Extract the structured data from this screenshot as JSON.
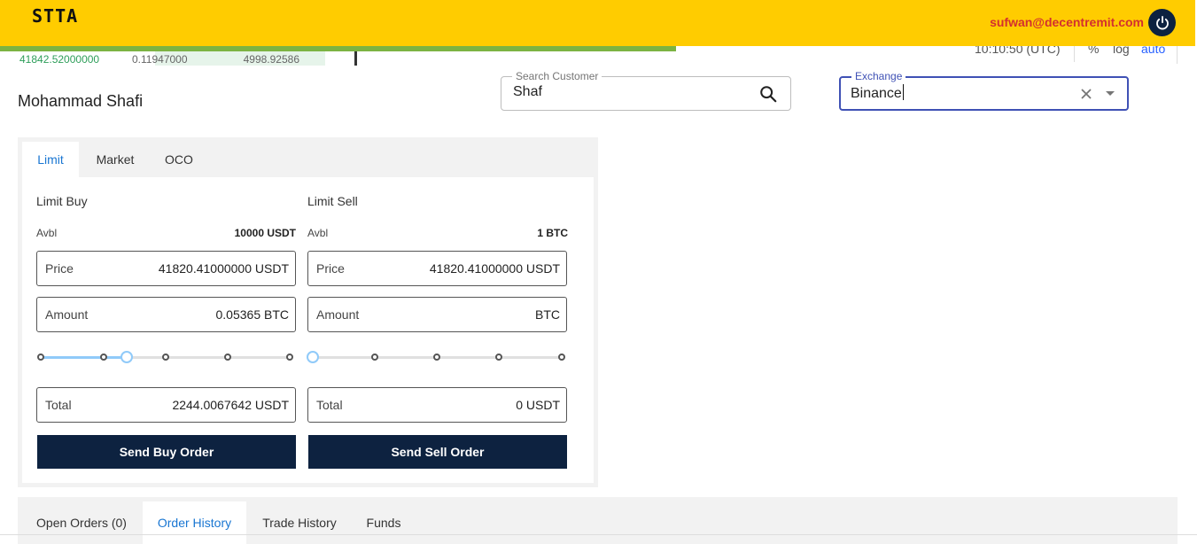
{
  "header": {
    "brand": "STTA",
    "user_email": "sufwan@decentremit.com",
    "power_icon": "power-icon",
    "colors": {
      "bar": "#ffcc00",
      "email": "#d32f2f",
      "power": "#0d2240"
    }
  },
  "background_strip": {
    "orderbook_row": {
      "price": "41842.52000000",
      "qty": "0.11947000",
      "total": "4998.92586"
    },
    "time": "10:10:50 (UTC)",
    "percent": "%",
    "log": "log",
    "auto": "auto"
  },
  "customer": {
    "name": "Mohammad Shafi"
  },
  "search": {
    "label": "Search Customer",
    "value": "Shaf"
  },
  "exchange": {
    "label": "Exchange",
    "value": "Binance"
  },
  "order_tabs": [
    "Limit",
    "Market",
    "OCO"
  ],
  "active_order_tab": "Limit",
  "buy": {
    "title": "Limit Buy",
    "avbl_label": "Avbl",
    "avbl_value": "10000 USDT",
    "price_label": "Price",
    "price_value": "41820.41000000 USDT",
    "amount_label": "Amount",
    "amount_value": "0.05365 BTC",
    "slider_percent": 25,
    "total_label": "Total",
    "total_value": "2244.0067642 USDT",
    "button": "Send Buy Order"
  },
  "sell": {
    "title": "Limit Sell",
    "avbl_label": "Avbl",
    "avbl_value": "1 BTC",
    "price_label": "Price",
    "price_value": "41820.41000000 USDT",
    "amount_label": "Amount",
    "amount_value": "BTC",
    "slider_percent": 0,
    "total_label": "Total",
    "total_value": "0 USDT",
    "button": "Send Sell Order"
  },
  "bottom_tabs": [
    "Open Orders (0)",
    "Order History",
    "Trade History",
    "Funds"
  ],
  "active_bottom_tab": "Order History"
}
